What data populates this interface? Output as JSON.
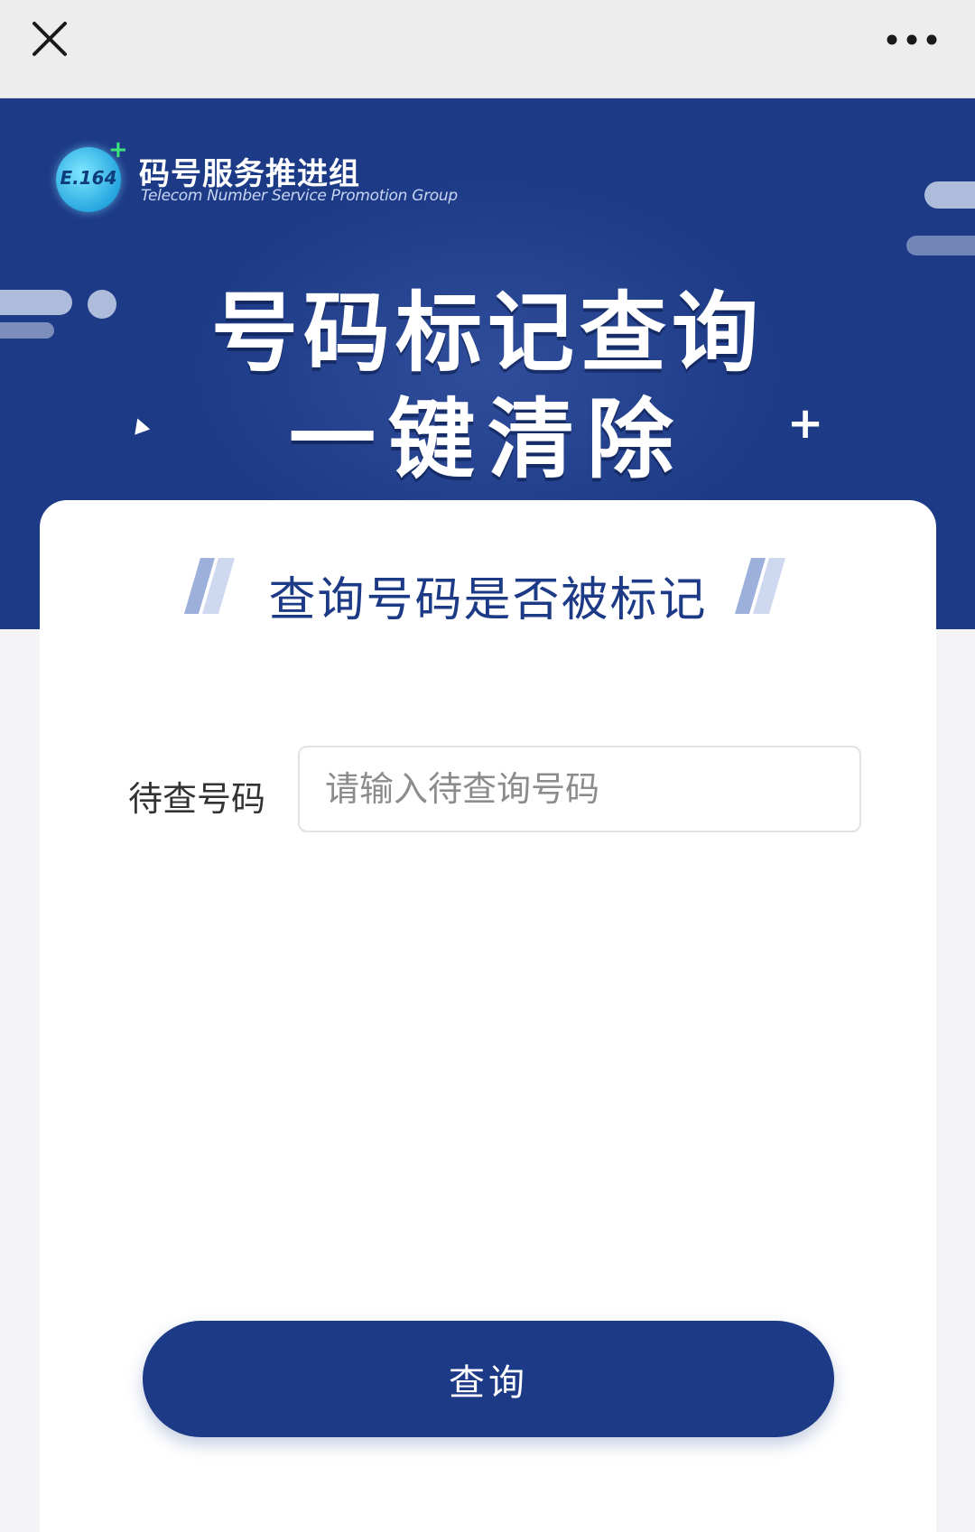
{
  "topbar": {
    "close_icon": "close-icon",
    "more_icon": "more-horizontal-icon"
  },
  "banner": {
    "logo_text": "E.164",
    "org_name_cn": "码号服务推进组",
    "org_name_en": "Telecom Number Service  Promotion Group",
    "headline_1": "号码标记查询",
    "headline_2": "一键清除"
  },
  "card": {
    "title": "查询号码是否被标记",
    "phone_label": "待查号码",
    "phone_value": "",
    "phone_placeholder": "请输入待查询号码",
    "submit_label": "查询"
  },
  "colors": {
    "brand": "#1d3a86",
    "topbar_bg": "#ededed",
    "page_bg": "#f4f4f6"
  }
}
